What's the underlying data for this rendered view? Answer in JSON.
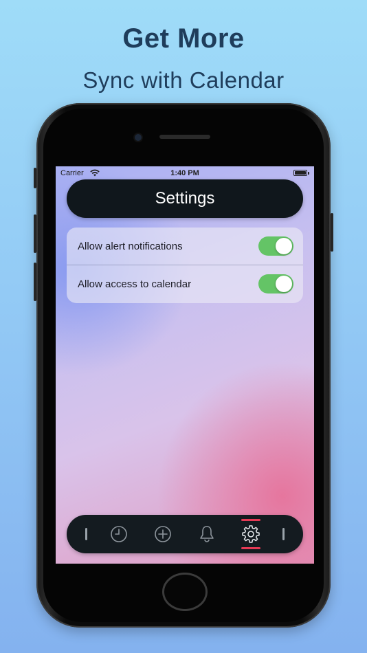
{
  "promo": {
    "title": "Get More",
    "subtitle": "Sync with Calendar"
  },
  "status_bar": {
    "carrier": "Carrier",
    "time": "1:40 PM"
  },
  "header": {
    "title": "Settings"
  },
  "settings": {
    "rows": [
      {
        "label": "Allow alert notifications",
        "enabled": true
      },
      {
        "label": "Allow access to calendar",
        "enabled": true
      }
    ]
  },
  "tab_bar": {
    "items": [
      {
        "icon": "clock-icon",
        "active": false
      },
      {
        "icon": "plus-circle-icon",
        "active": false
      },
      {
        "icon": "bell-icon",
        "active": false
      },
      {
        "icon": "gear-icon",
        "active": true
      }
    ],
    "accent_color": "#e63a55"
  },
  "colors": {
    "toggle_on": "#64c466",
    "header_bg": "#10171c",
    "promo_text": "#1f3d5b"
  }
}
